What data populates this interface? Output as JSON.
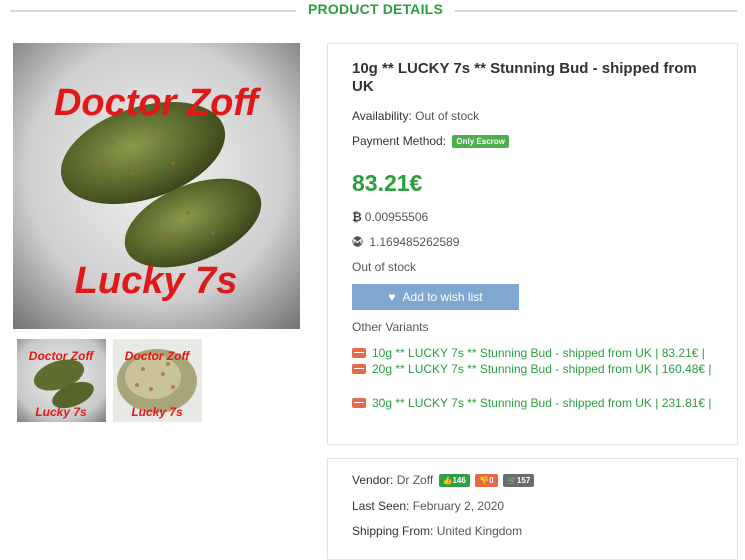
{
  "section": {
    "title": "PRODUCT DETAILS"
  },
  "gallery": {
    "main": {
      "top_text": "Doctor Zoff",
      "bottom_text": "Lucky 7s"
    },
    "thumbs": [
      {
        "top_text": "Doctor Zoff",
        "bottom_text": "Lucky 7s"
      },
      {
        "top_text": "Doctor Zoff",
        "bottom_text": "Lucky 7s"
      }
    ]
  },
  "product": {
    "title": "10g ** LUCKY 7s ** Stunning Bud - shipped from UK",
    "availability_label": "Availability:",
    "availability_value": "Out of stock",
    "payment_label": "Payment Method:",
    "payment_badge": "Only Escrow",
    "price": "83.21€",
    "btc_icon": "bitcoin-icon",
    "btc_value": "0.00955506",
    "xmr_icon": "monero-icon",
    "xmr_value": "1.169485262589",
    "stock_status": "Out of stock",
    "wishlist_button": "Add to wish list",
    "variants_label": "Other Variants",
    "variants": [
      {
        "text": "10g ** LUCKY 7s ** Stunning Bud - shipped from UK  |  83.21€  |"
      },
      {
        "text": "20g ** LUCKY 7s ** Stunning Bud - shipped from UK  |  160.48€  |"
      },
      {
        "text": "30g ** LUCKY 7s ** Stunning Bud - shipped from UK  |  231.81€  |"
      }
    ]
  },
  "vendor": {
    "label": "Vendor:",
    "name": "Dr Zoff",
    "positive": "146",
    "negative": "0",
    "orders": "157",
    "last_seen_label": "Last Seen:",
    "last_seen_value": "February 2, 2020",
    "shipping_label": "Shipping From:",
    "shipping_value": "United Kingdom"
  },
  "colors": {
    "accent": "#2a9d3f",
    "wishlist": "#7fa7cf",
    "variant_icon": "#e8684a"
  }
}
